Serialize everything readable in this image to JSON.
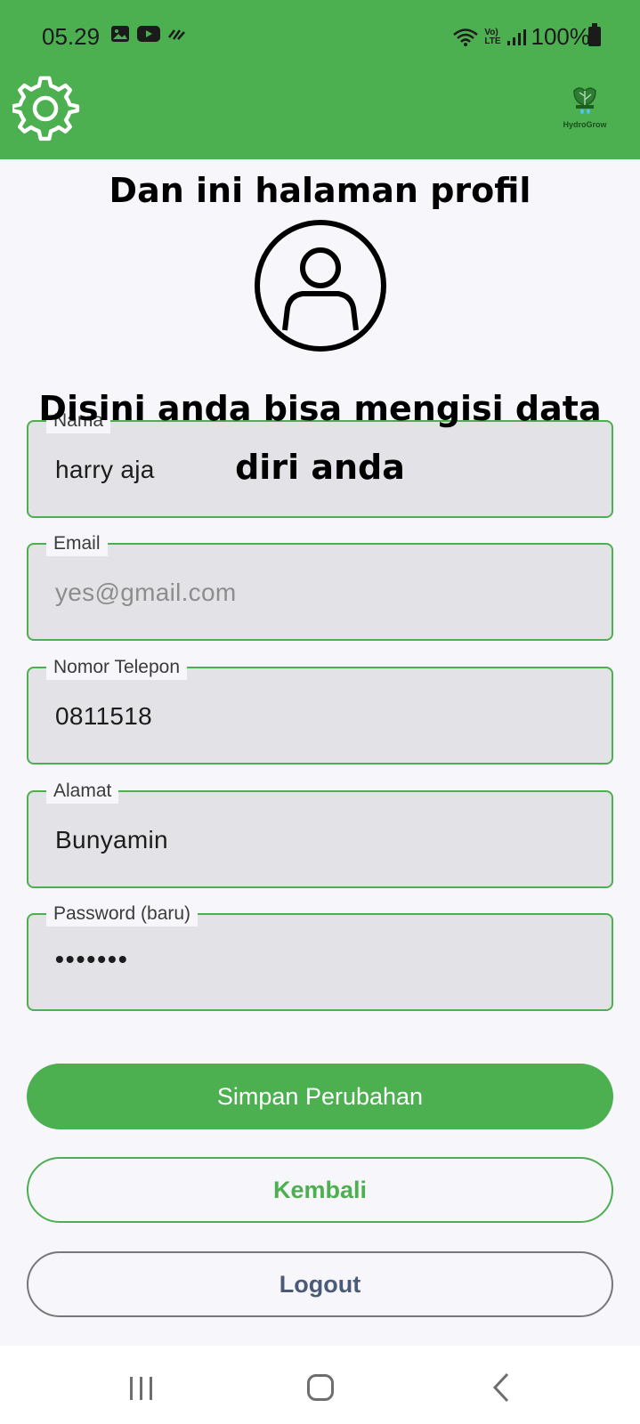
{
  "status": {
    "time": "05.29",
    "battery": "100%",
    "network_label_top": "Vo)",
    "network_label_bottom": "LTE"
  },
  "appbar": {
    "settings_icon": "gear-icon",
    "logo_text": "HydroGrow"
  },
  "overlay": {
    "title": "Dan ini halaman profil",
    "subtitle": "Disini anda bisa mengisi data diri anda"
  },
  "profile": {
    "avatar_icon": "user-circle-icon"
  },
  "form": {
    "nama": {
      "label": "Nama",
      "value": "harry aja"
    },
    "email": {
      "label": "Email",
      "placeholder": "yes@gmail.com"
    },
    "telepon": {
      "label": "Nomor Telepon",
      "value": "0811518"
    },
    "alamat": {
      "label": "Alamat",
      "value": "Bunyamin"
    },
    "password": {
      "label": "Password (baru)",
      "value": "•••••••"
    }
  },
  "buttons": {
    "save": "Simpan Perubahan",
    "back": "Kembali",
    "logout": "Logout"
  },
  "colors": {
    "primary": "#4caf50",
    "field_bg": "#e3e3e7",
    "logout_text": "#4a5a78"
  }
}
